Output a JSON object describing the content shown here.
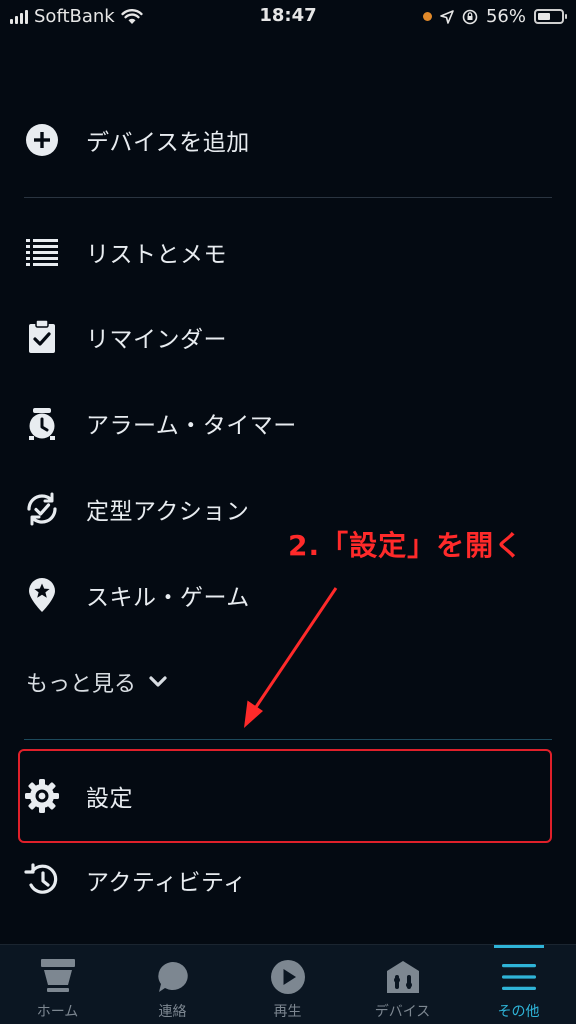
{
  "status_bar": {
    "carrier": "SoftBank",
    "time": "18:47",
    "battery": "56%",
    "battery_level": 0.56
  },
  "menu": {
    "add_device": "デバイスを追加",
    "lists_notes": "リストとメモ",
    "reminders": "リマインダー",
    "alarms_timers": "アラーム・タイマー",
    "routines": "定型アクション",
    "skills_games": "スキル・ゲーム",
    "see_more": "もっと見る",
    "settings": "設定",
    "activity": "アクティビティ"
  },
  "annotation": {
    "text": "2.「設定」を開く",
    "color": "#ff2a2a"
  },
  "tabs": [
    {
      "label": "ホーム",
      "icon": "home-icon"
    },
    {
      "label": "連絡",
      "icon": "chat-icon"
    },
    {
      "label": "再生",
      "icon": "play-icon"
    },
    {
      "label": "デバイス",
      "icon": "devices-icon"
    },
    {
      "label": "その他",
      "icon": "more-icon",
      "active": true
    }
  ],
  "colors": {
    "background": "#040a12",
    "accent": "#2fb4d8",
    "highlight": "#e0202a"
  }
}
